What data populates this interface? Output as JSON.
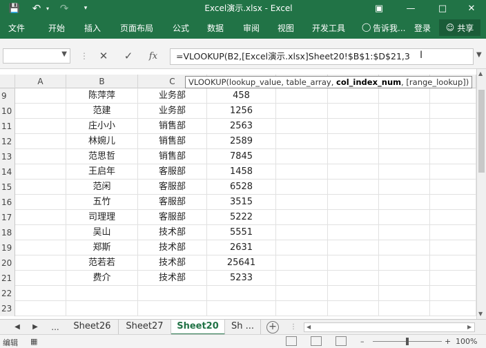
{
  "app": {
    "title": "Excel演示.xlsx - Excel",
    "quick_access": [
      "save-icon",
      "undo-icon",
      "redo-icon",
      "customize-icon"
    ],
    "window_controls": [
      "ribbon-display-icon",
      "minimize-icon",
      "maximize-icon",
      "close-icon"
    ]
  },
  "ribbon": {
    "tabs": [
      "文件",
      "开始",
      "插入",
      "页面布局",
      "公式",
      "数据",
      "审阅",
      "视图",
      "开发工具"
    ],
    "tell_me": "告诉我...",
    "signin": "登录",
    "share": "共享"
  },
  "formula_bar": {
    "name_box": "",
    "formula": "=VLOOKUP(B2,[Excel演示.xlsx]Sheet20!$B$1:$D$21,3",
    "fx_label": "fx"
  },
  "tooltip": {
    "prefix": "VLOOKUP(lookup_value, table_array, ",
    "bold": "col_index_num",
    "suffix": ", [range_lookup])"
  },
  "grid": {
    "columns": [
      "A",
      "B",
      "C"
    ],
    "rows": [
      {
        "num": "9",
        "b": "陈萍萍",
        "c": "业务部",
        "d": "458"
      },
      {
        "num": "10",
        "b": "范建",
        "c": "业务部",
        "d": "1256"
      },
      {
        "num": "11",
        "b": "庄小小",
        "c": "销售部",
        "d": "2563"
      },
      {
        "num": "12",
        "b": "林婉儿",
        "c": "销售部",
        "d": "2589"
      },
      {
        "num": "13",
        "b": "范思哲",
        "c": "销售部",
        "d": "7845"
      },
      {
        "num": "14",
        "b": "王启年",
        "c": "客服部",
        "d": "1458"
      },
      {
        "num": "15",
        "b": "范闲",
        "c": "客服部",
        "d": "6528"
      },
      {
        "num": "16",
        "b": "五竹",
        "c": "客服部",
        "d": "3515"
      },
      {
        "num": "17",
        "b": "司理理",
        "c": "客服部",
        "d": "5222"
      },
      {
        "num": "18",
        "b": "吴山",
        "c": "技术部",
        "d": "5551"
      },
      {
        "num": "19",
        "b": "郑斯",
        "c": "技术部",
        "d": "2631"
      },
      {
        "num": "20",
        "b": "范若若",
        "c": "技术部",
        "d": "25641"
      },
      {
        "num": "21",
        "b": "费介",
        "c": "技术部",
        "d": "5233"
      },
      {
        "num": "22",
        "b": "",
        "c": "",
        "d": ""
      },
      {
        "num": "23",
        "b": "",
        "c": "",
        "d": ""
      }
    ]
  },
  "sheets": {
    "more": "...",
    "tabs": [
      "Sheet26",
      "Sheet27",
      "Sheet20",
      "Sh ..."
    ],
    "active_index": 2
  },
  "status": {
    "mode": "编辑",
    "zoom": "100%"
  },
  "colors": {
    "accent": "#217346"
  }
}
